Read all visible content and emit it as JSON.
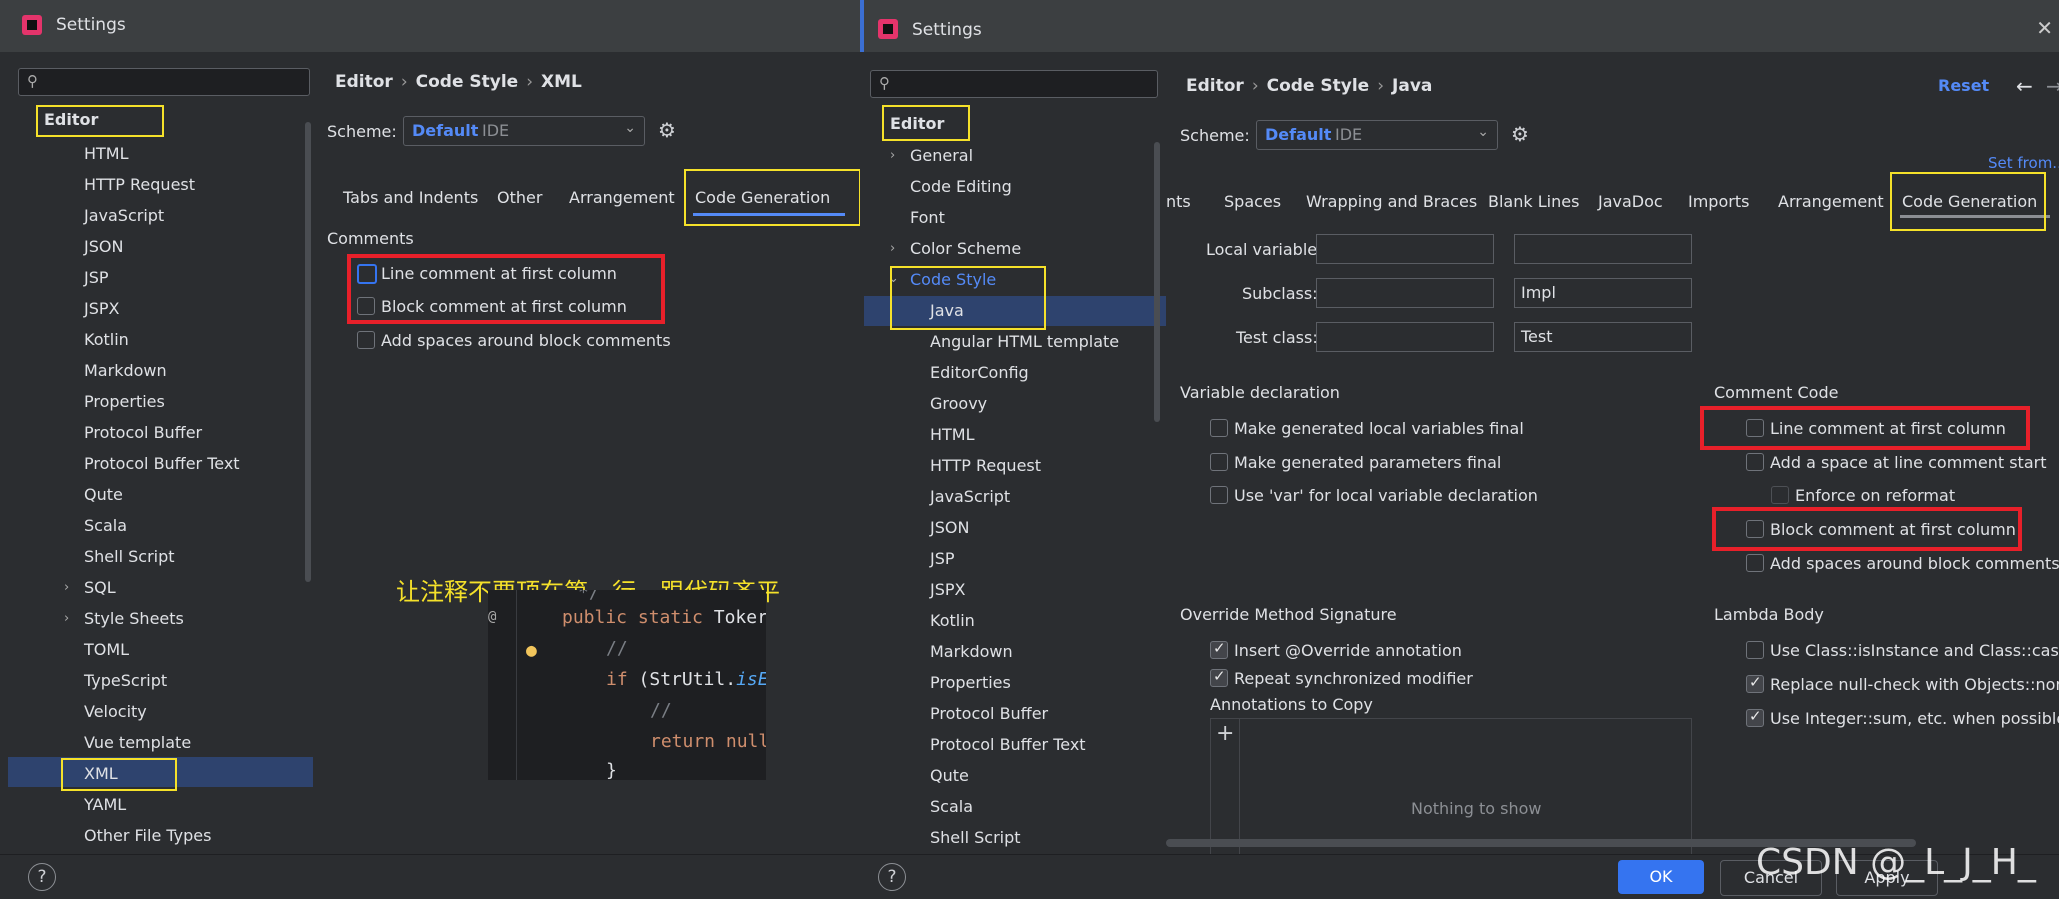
{
  "left_window": {
    "title": "Settings",
    "search": {
      "placeholder": ""
    },
    "tree": {
      "editor": "Editor",
      "items": [
        "HTML",
        "HTTP Request",
        "JavaScript",
        "JSON",
        "JSP",
        "JSPX",
        "Kotlin",
        "Markdown",
        "Properties",
        "Protocol Buffer",
        "Protocol Buffer Text",
        "Qute",
        "Scala",
        "Shell Script",
        "SQL",
        "Style Sheets",
        "TOML",
        "TypeScript",
        "Velocity",
        "Vue template",
        "XML",
        "YAML",
        "Other File Types"
      ]
    },
    "breadcrumb": {
      "a": "Editor",
      "b": "Code Style",
      "c": "XML",
      "sep": "›"
    },
    "scheme": {
      "label": "Scheme:",
      "value": "Default",
      "scope": "IDE"
    },
    "tabs": [
      "Tabs and Indents",
      "Other",
      "Arrangement",
      "Code Generation"
    ],
    "comments": {
      "section": "Comments",
      "line_comment": "Line comment at first column",
      "block_comment": "Block comment at first column",
      "add_spaces": "Add spaces around block comments"
    },
    "annotation": "让注释不要顶在第一行，跟代码齐平",
    "code": {
      "l0": "*/",
      "l1_kw": "public static",
      "l1_rest": " Toker",
      "l2": "//",
      "l3_kw": "if",
      "l3_rest": " (StrUtil.",
      "l3_fn": "isE",
      "l4": "//",
      "l5_kw": "return null",
      "l6": "}"
    }
  },
  "right_window": {
    "title": "Settings",
    "search": {
      "placeholder": ""
    },
    "tree": {
      "editor": "Editor",
      "general": "General",
      "code_editing": "Code Editing",
      "font": "Font",
      "color_scheme": "Color Scheme",
      "code_style": "Code Style",
      "items": [
        "Java",
        "Angular HTML template",
        "EditorConfig",
        "Groovy",
        "HTML",
        "HTTP Request",
        "JavaScript",
        "JSON",
        "JSP",
        "JSPX",
        "Kotlin",
        "Markdown",
        "Properties",
        "Protocol Buffer",
        "Protocol Buffer Text",
        "Qute",
        "Scala",
        "Shell Script"
      ]
    },
    "breadcrumb": {
      "a": "Editor",
      "b": "Code Style",
      "c": "Java",
      "sep": "›"
    },
    "reset": "Reset",
    "nav": {
      "back": "←",
      "forward": "→"
    },
    "set_from": "Set from...",
    "scheme": {
      "label": "Scheme:",
      "value": "Default",
      "scope": "IDE"
    },
    "tabs": [
      "nts",
      "Spaces",
      "Wrapping and Braces",
      "Blank Lines",
      "JavaDoc",
      "Imports",
      "Arrangement",
      "Code Generation"
    ],
    "naming": {
      "local_variable": "Local variable:",
      "subclass": "Subclass:",
      "subclass_suffix": "Impl",
      "test_class": "Test class:",
      "test_suffix": "Test"
    },
    "variable_declaration": {
      "section": "Variable declaration",
      "opt1": "Make generated local variables final",
      "opt2": "Make generated parameters final",
      "opt3": "Use 'var' for local variable declaration"
    },
    "comment_code": {
      "section": "Comment Code",
      "line_comment": "Line comment at first column",
      "add_space": "Add a space at line comment start",
      "enforce": "Enforce on reformat",
      "block_comment": "Block comment at first column",
      "add_spaces": "Add spaces around block comments"
    },
    "override": {
      "section": "Override Method Signature",
      "opt1": "Insert @Override annotation",
      "opt2": "Repeat synchronized modifier",
      "annotations": "Annotations to Copy",
      "add": "+",
      "empty": "Nothing to show"
    },
    "lambda": {
      "section": "Lambda Body",
      "opt1": "Use Class::isInstance and Class::cast whe",
      "opt2": "Replace null-check with Objects::nonNul",
      "opt3": "Use Integer::sum, etc. when possible"
    },
    "buttons": {
      "ok": "OK",
      "cancel": "Cancel",
      "apply": "Apply"
    }
  },
  "watermark": "CSDN @_L_J_H_"
}
